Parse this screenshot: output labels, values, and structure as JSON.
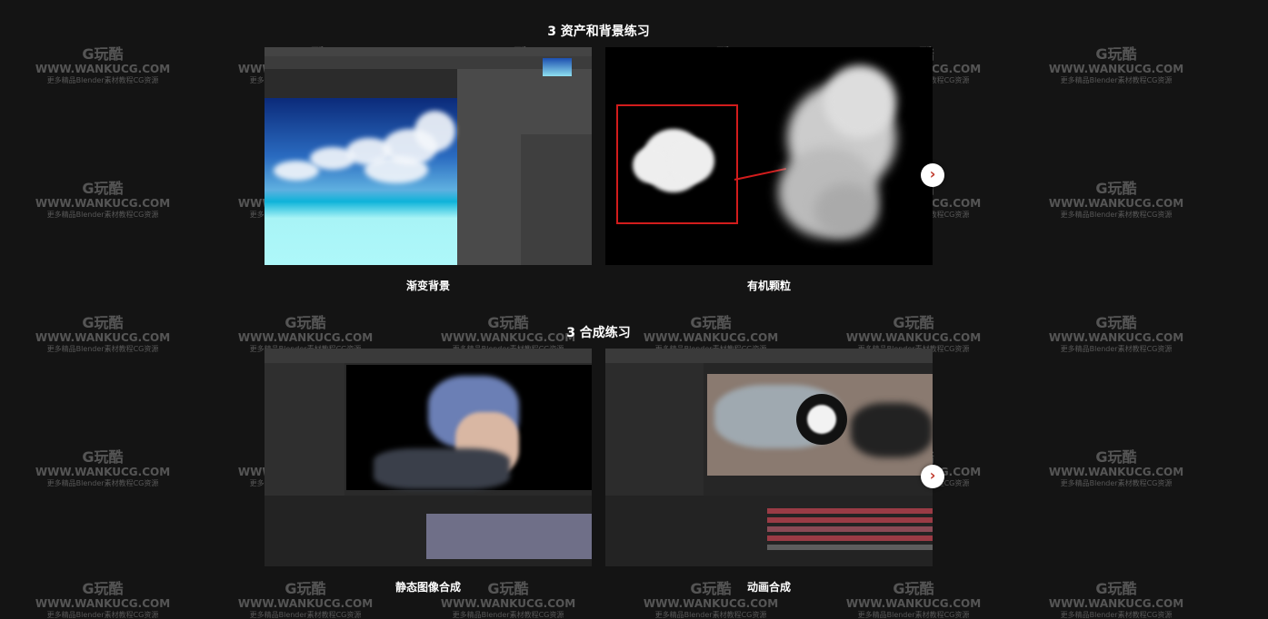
{
  "sections": [
    {
      "title": "3 资产和背景练习",
      "cards": [
        {
          "caption": "渐变背景"
        },
        {
          "caption": "有机颗粒"
        }
      ]
    },
    {
      "title": "3 合成练习",
      "cards": [
        {
          "caption": "静态图像合成"
        },
        {
          "caption": "动画合成"
        }
      ]
    }
  ],
  "nav": {
    "next_glyph": "›"
  },
  "watermark": {
    "logo": "G玩酷",
    "url": "WWW.WANKUCG.COM",
    "tagline": "更多精品Blender素材教程CG资源"
  },
  "colors": {
    "background": "#141414",
    "accent_red": "#d21c1c"
  }
}
